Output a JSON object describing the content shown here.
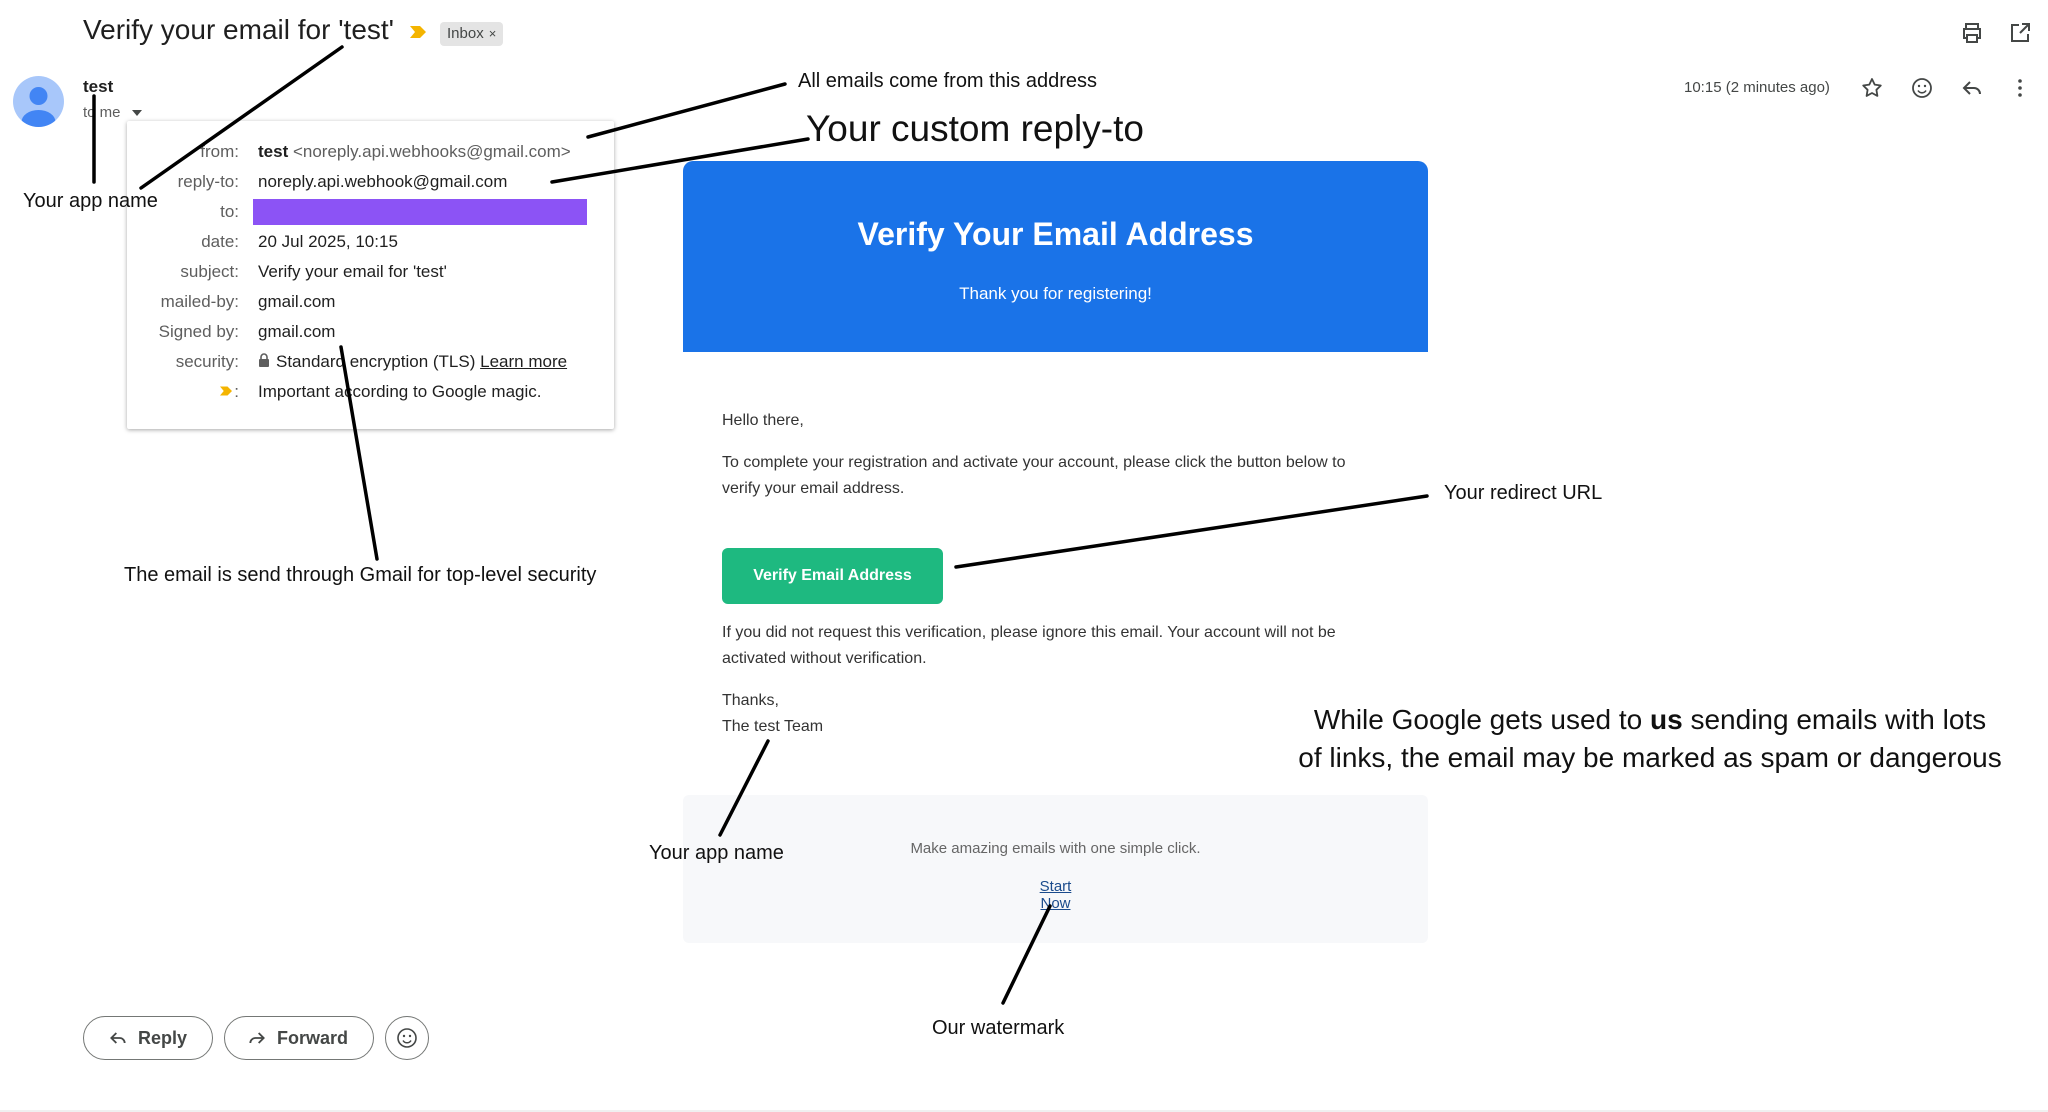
{
  "email": {
    "subject": "Verify your email for 'test'",
    "label": "Inbox",
    "label_close": "×",
    "sender_name": "test",
    "recipient_line": "to me",
    "timestamp": "10:15 (2 minutes ago)"
  },
  "details_popup": {
    "rows": [
      {
        "label": "from:",
        "sender": "test",
        "address": "<noreply.api.webhooks@gmail.com>"
      },
      {
        "label": "reply-to:",
        "value": "noreply.api.webhook@gmail.com"
      },
      {
        "label": "to:",
        "value": ""
      },
      {
        "label": "date:",
        "value": "20 Jul 2025, 10:15"
      },
      {
        "label": "subject:",
        "value": "Verify your email for 'test'"
      },
      {
        "label": "mailed-by:",
        "value": "gmail.com"
      },
      {
        "label": "Signed by:",
        "value": "gmail.com"
      },
      {
        "label": "security:",
        "value": "Standard encryption (TLS)",
        "link": "Learn more"
      },
      {
        "label": ":",
        "value": "Important according to Google magic."
      }
    ],
    "redaction_color": "#8c53f5"
  },
  "message": {
    "header_title": "Verify Your Email Address",
    "header_subtitle": "Thank you for registering!",
    "header_color": "#1a73e8",
    "greeting": "Hello there,",
    "intro_line1": "To complete your registration and activate your account, please click the button below to",
    "intro_line2": "verify your email address.",
    "button_label": "Verify Email Address",
    "button_color": "#1eb980",
    "ignore_line1": "If you did not request this verification, please ignore this email. Your account will not be",
    "ignore_line2": "activated without verification.",
    "signoff": "Thanks,",
    "team": "The test Team",
    "footer_tagline": "Make amazing emails with one simple click.",
    "footer_link": "Start Now"
  },
  "actions": {
    "reply": "Reply",
    "forward": "Forward"
  },
  "annotations": {
    "app_name_top": "Your app name",
    "from_address": "All emails come from this address",
    "reply_to": "Your custom reply-to",
    "gmail_security": "The email is send through Gmail for top-level security",
    "redirect_url": "Your redirect URL",
    "spam_note_line1_pre": "While Google gets used to ",
    "spam_note_line1_bold": "us",
    "spam_note_line1_post": " sending emails with lots",
    "spam_note_line2": "of links, the email may be marked as spam or dangerous",
    "app_name_bottom": "Your app name",
    "watermark": "Our watermark"
  },
  "icons": [
    "importance-marker-icon",
    "print-icon",
    "open-in-new-icon",
    "star-icon",
    "emoji-icon",
    "reply-icon",
    "more-vert-icon",
    "caret-down-icon",
    "lock-icon",
    "forward-icon"
  ]
}
